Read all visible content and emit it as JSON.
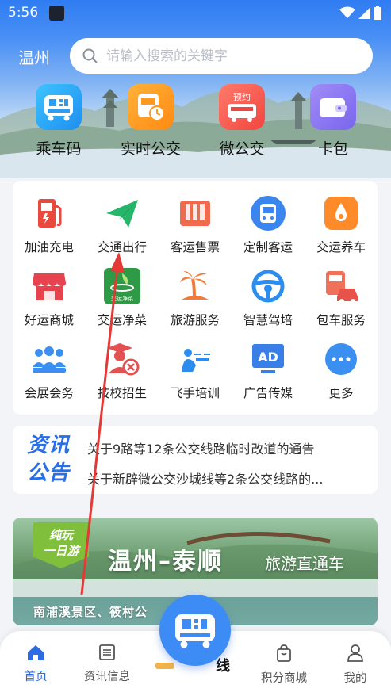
{
  "status_bar": {
    "time": "5:56"
  },
  "header": {
    "city": "温州",
    "search": {
      "placeholder": "请输入搜索的关键字"
    }
  },
  "quick_actions": [
    {
      "label": "乘车码",
      "icon": "qr-bus-icon",
      "color": "#2fa6f5"
    },
    {
      "label": "实时公交",
      "icon": "bus-clock-icon",
      "color": "#ff9a1f"
    },
    {
      "label": "微公交",
      "icon": "reserve-bus-icon",
      "color": "#ff5a4e",
      "badge": "预约"
    },
    {
      "label": "卡包",
      "icon": "wallet-icon",
      "color": "#8a74f0"
    }
  ],
  "services": [
    {
      "label": "加油充电",
      "icon": "fuel-icon"
    },
    {
      "label": "交通出行",
      "icon": "paper-plane-icon"
    },
    {
      "label": "客运售票",
      "icon": "ticket-icon"
    },
    {
      "label": "定制客运",
      "icon": "custom-bus-icon"
    },
    {
      "label": "交运养车",
      "icon": "car-oil-icon"
    },
    {
      "label": "好运商城",
      "icon": "shop-icon"
    },
    {
      "label": "交运净菜",
      "icon": "vegetable-icon",
      "icon_text": "交运净菜"
    },
    {
      "label": "旅游服务",
      "icon": "palm-tree-icon"
    },
    {
      "label": "智慧驾培",
      "icon": "steering-wheel-icon"
    },
    {
      "label": "包车服务",
      "icon": "charter-icon"
    },
    {
      "label": "会展会务",
      "icon": "meeting-icon"
    },
    {
      "label": "技校招生",
      "icon": "graduate-icon"
    },
    {
      "label": "飞手培训",
      "icon": "drone-icon"
    },
    {
      "label": "广告传媒",
      "icon": "ad-icon",
      "icon_text": "AD"
    },
    {
      "label": "更多",
      "icon": "more-icon"
    }
  ],
  "news": {
    "logo_line1": "资讯",
    "logo_line2": "公告",
    "items": [
      "关于9路等12条公交线路临时改道的通告",
      "关于新辟微公交沙城线等2条公交线路的..."
    ]
  },
  "banner": {
    "badge_line1": "纯玩",
    "badge_line2": "一日游",
    "title": "温州–泰顺",
    "subtitle": "旅游直通车",
    "location": "南浦溪景区、筱村公"
  },
  "tabbar": {
    "tabs": [
      {
        "label": "首页",
        "icon": "home-icon",
        "active": true
      },
      {
        "label": "资讯信息",
        "icon": "news-list-icon",
        "active": false
      },
      {
        "label": "积分商城",
        "icon": "shopping-bag-icon",
        "active": false
      },
      {
        "label": "我的",
        "icon": "person-icon",
        "active": false
      }
    ],
    "peek_text": "线"
  },
  "colors": {
    "accent": "#2d6be4",
    "arrow": "#e53935"
  }
}
